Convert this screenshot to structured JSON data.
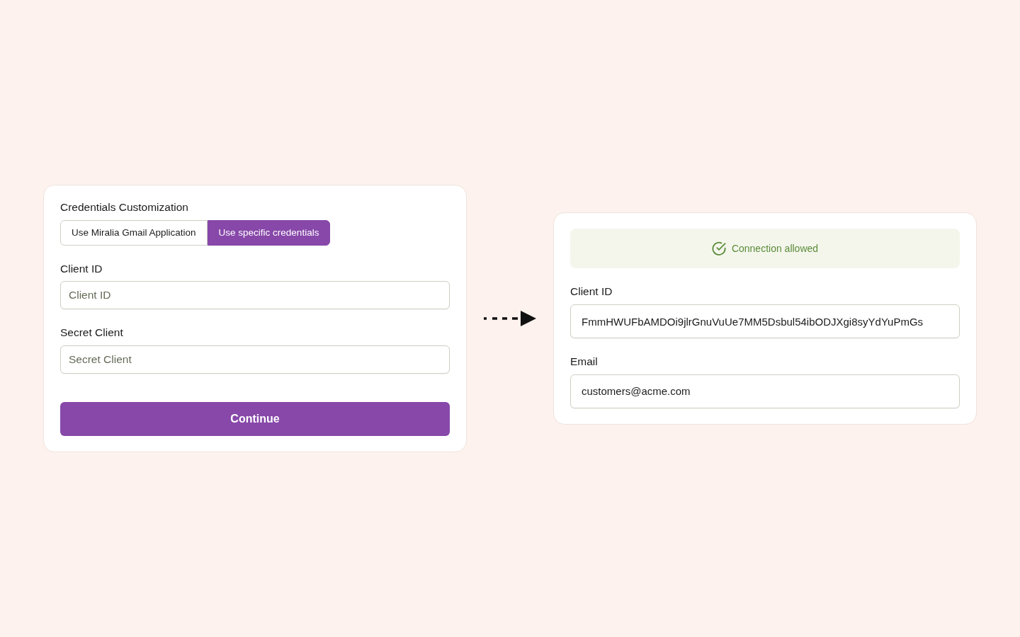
{
  "setup_form": {
    "title": "Credentials Customization",
    "options": [
      {
        "label": "Use Miralia Gmail Application",
        "selected": false
      },
      {
        "label": "Use specific credentials",
        "selected": true
      }
    ],
    "fields": [
      {
        "label": "Client ID",
        "placeholder": "Client ID"
      },
      {
        "label": "Secret Client",
        "placeholder": "Secret Client"
      }
    ],
    "submit_button": "Continue"
  },
  "result_panel": {
    "status": {
      "text": "Connection allowed"
    },
    "fields": [
      {
        "label": "Client ID",
        "value": "FmmHWUFbAMDOi9jlrGnuVuUe7MM5Dsbul54ibODJXgi8syYdYuPmGs"
      },
      {
        "label": "Email",
        "value": "customers@acme.com"
      }
    ]
  }
}
